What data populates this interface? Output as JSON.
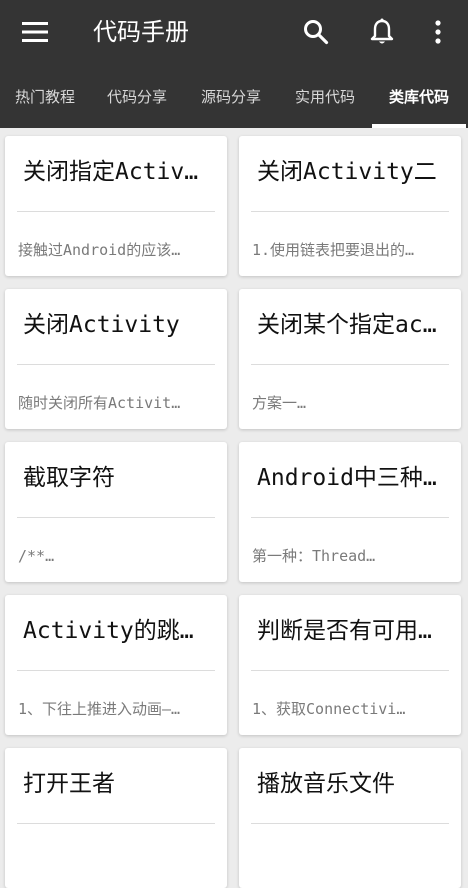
{
  "app": {
    "title": "代码手册"
  },
  "toolbar": {
    "icons": [
      "menu-icon",
      "search-icon",
      "bell-icon",
      "more-vert-icon"
    ]
  },
  "tabs": [
    {
      "label": "热门教程",
      "active": false
    },
    {
      "label": "代码分享",
      "active": false
    },
    {
      "label": "源码分享",
      "active": false
    },
    {
      "label": "实用代码",
      "active": false
    },
    {
      "label": "类库代码",
      "active": true
    }
  ],
  "cards": [
    {
      "title": "关闭指定Activ…",
      "desc": "接触过Android的应该…"
    },
    {
      "title": "关闭Activity二",
      "desc": "1.使用链表把要退出的…"
    },
    {
      "title": "关闭Activity",
      "desc": "随时关闭所有Activit…"
    },
    {
      "title": "关闭某个指定ac…",
      "desc": "方案一…"
    },
    {
      "title": "截取字符",
      "desc": "/**…"
    },
    {
      "title": "Android中三种…",
      "desc": "第一种：Thread…"
    },
    {
      "title": "Activity的跳…",
      "desc": "1、下往上推进入动画—…"
    },
    {
      "title": "判断是否有可用…",
      "desc": "1、获取Connectivi…"
    },
    {
      "title": "打开王者",
      "desc": ""
    },
    {
      "title": "播放音乐文件",
      "desc": ""
    }
  ],
  "colors": {
    "appbar": "#343434",
    "background": "#ececec",
    "card": "#ffffff",
    "tab_indicator": "#ffffff"
  }
}
